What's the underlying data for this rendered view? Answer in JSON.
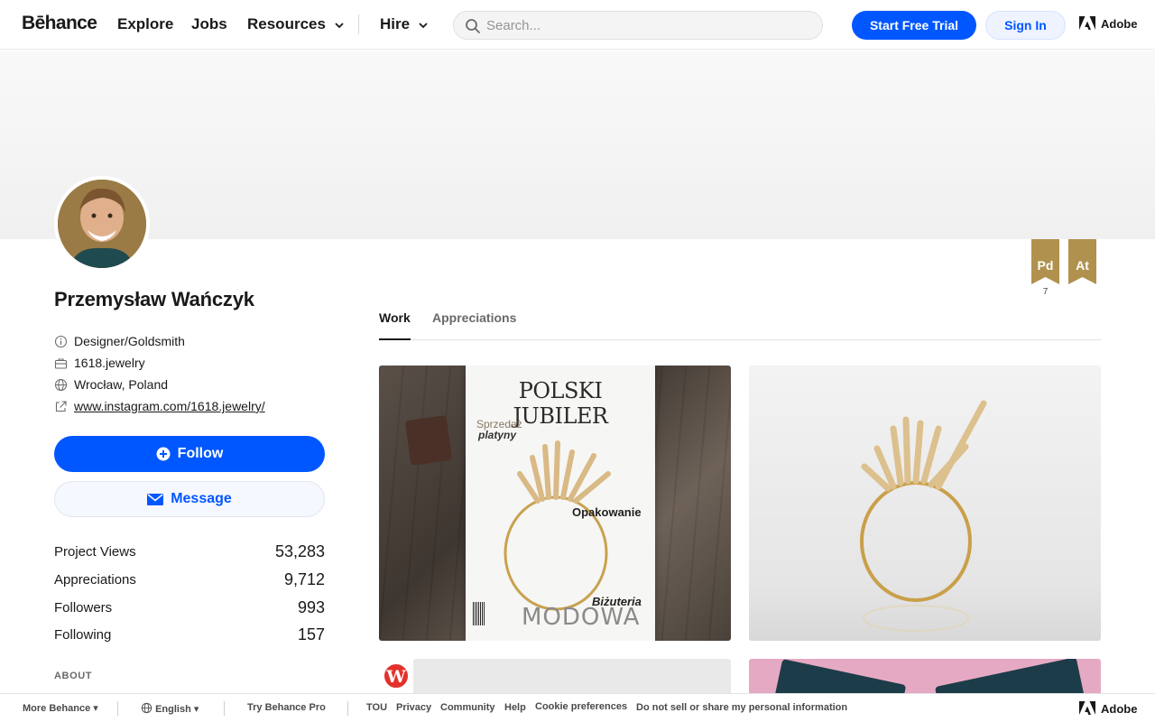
{
  "nav": {
    "logo": "Bēhance",
    "explore": "Explore",
    "jobs": "Jobs",
    "resources": "Resources",
    "hire": "Hire",
    "search_placeholder": "Search...",
    "start_trial": "Start Free Trial",
    "sign_in": "Sign In",
    "adobe": "Adobe"
  },
  "profile": {
    "name": "Przemysław Wańczyk",
    "occupation": "Designer/Goldsmith",
    "company": "1618.jewelry",
    "location": "Wrocław, Poland",
    "website": "www.instagram.com/1618.jewelry/",
    "follow_label": "Follow",
    "message_label": "Message",
    "about_label": "ABOUT"
  },
  "stats": [
    {
      "label": "Project Views",
      "value": "53,283"
    },
    {
      "label": "Appreciations",
      "value": "9,712"
    },
    {
      "label": "Followers",
      "value": "993"
    },
    {
      "label": "Following",
      "value": "157"
    }
  ],
  "badges": [
    {
      "label": "Pd",
      "count": "7"
    },
    {
      "label": "At",
      "count": ""
    }
  ],
  "tabs": [
    {
      "label": "Work",
      "active": true
    },
    {
      "label": "Appreciations",
      "active": false
    }
  ],
  "projects": {
    "magazine": {
      "title": "POLSKI JUBILER",
      "sub1": "Sprzedaż",
      "sub2": "platyny",
      "feature1": "Opakowanie",
      "feature2": "Biżuteria",
      "footer": "MODOWA"
    },
    "owner_badge": "W"
  },
  "footer": {
    "more": "More Behance",
    "language": "English",
    "try_pro": "Try Behance Pro",
    "tou": "TOU",
    "privacy": "Privacy",
    "community": "Community",
    "help": "Help",
    "cookies": "Cookie preferences",
    "do_not_sell": "Do not sell or share my personal information",
    "adobe": "Adobe"
  },
  "colors": {
    "accent": "#0057ff",
    "badge": "#b0914e"
  }
}
